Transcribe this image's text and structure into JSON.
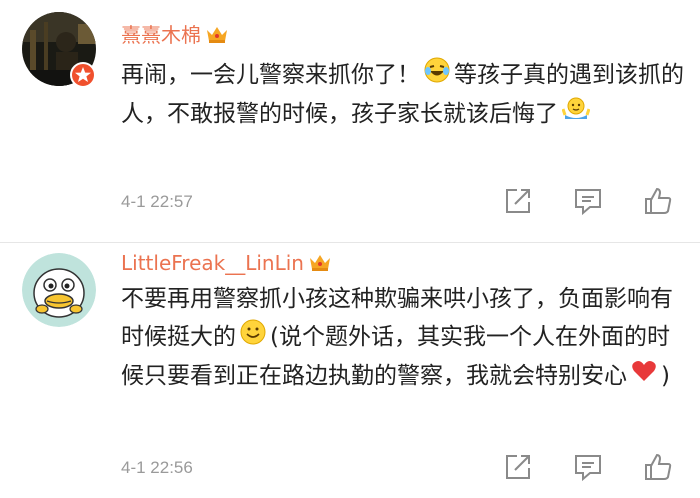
{
  "comments": [
    {
      "username": "熹熹木棉",
      "content_line_a": "再闹，一会儿警察来抓你了！",
      "content_line_b": "等孩子真的遇到该抓的人，不敢报警的时候，孩子家长就该后悔了",
      "timestamp": "4-1 22:57",
      "avatar_icon": "dark-photo-avatar",
      "badges": [
        "crown-icon",
        "verified-badge-icon"
      ],
      "emojis": [
        "laughing-crying-emoji",
        "shrug-emoji"
      ]
    },
    {
      "username": "LittleFreak__LinLin",
      "content_line_a": "不要再用警察抓小孩这种欺骗来哄小孩了，负面影响有时候挺大的",
      "content_line_b": "(说个题外话，其实我一个人在外面的时候只要看到正在路边执勤的警察，我就会特别安心",
      "content_line_c": ")",
      "timestamp": "4-1 22:56",
      "avatar_icon": "cartoon-duck-avatar",
      "badges": [
        "crown-icon"
      ],
      "emojis": [
        "smile-emoji",
        "red-heart-emoji"
      ]
    }
  ],
  "actions": {
    "icons": [
      "share-icon",
      "reply-icon",
      "like-icon"
    ]
  },
  "colors": {
    "username": "#eb7350",
    "text": "#222222",
    "timestamp": "#9a9a9a",
    "icon": "#8a8a8a",
    "divider": "#e6e6e6",
    "crown": "#f6a623"
  }
}
